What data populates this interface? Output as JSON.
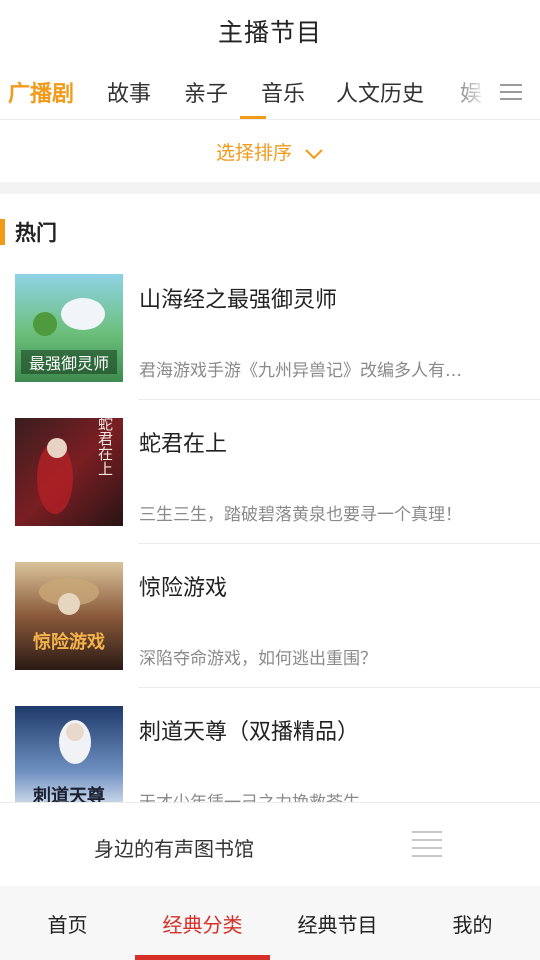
{
  "header": {
    "title": "主播节目"
  },
  "tabs": {
    "items": [
      {
        "label": "广播剧"
      },
      {
        "label": "故事"
      },
      {
        "label": "亲子"
      },
      {
        "label": "音乐"
      },
      {
        "label": "人文历史"
      },
      {
        "label": "娱"
      }
    ],
    "active_label": "广播剧",
    "menu_icon": "hamburger-menu-icon"
  },
  "sort": {
    "label": "选择排序",
    "icon": "chevron-down-icon"
  },
  "section": {
    "title": "热门"
  },
  "programs": [
    {
      "title": "山海经之最强御灵师",
      "desc": "君海游戏手游《九州异兽记》改编多人有…",
      "cover_text": "最强御灵师"
    },
    {
      "title": "蛇君在上",
      "desc": "三生三生，踏破碧落黄泉也要寻一个真理！",
      "cover_text": "蛇君在上"
    },
    {
      "title": "惊险游戏",
      "desc": "深陷夺命游戏，如何逃出重围？",
      "cover_text": "惊险游戏"
    },
    {
      "title": "刺道天尊（双播精品）",
      "desc": "天才少年凭一己之力挽救苍生。",
      "cover_text": "刺道天尊"
    }
  ],
  "library": {
    "label": "身边的有声图书馆",
    "icon": "list-icon"
  },
  "bottom_nav": {
    "items": [
      {
        "label": "首页"
      },
      {
        "label": "经典分类"
      },
      {
        "label": "经典节目"
      },
      {
        "label": "我的"
      }
    ],
    "active_label": "经典分类"
  },
  "colors": {
    "accent": "#f29a1a",
    "nav_active": "#d5312a"
  }
}
